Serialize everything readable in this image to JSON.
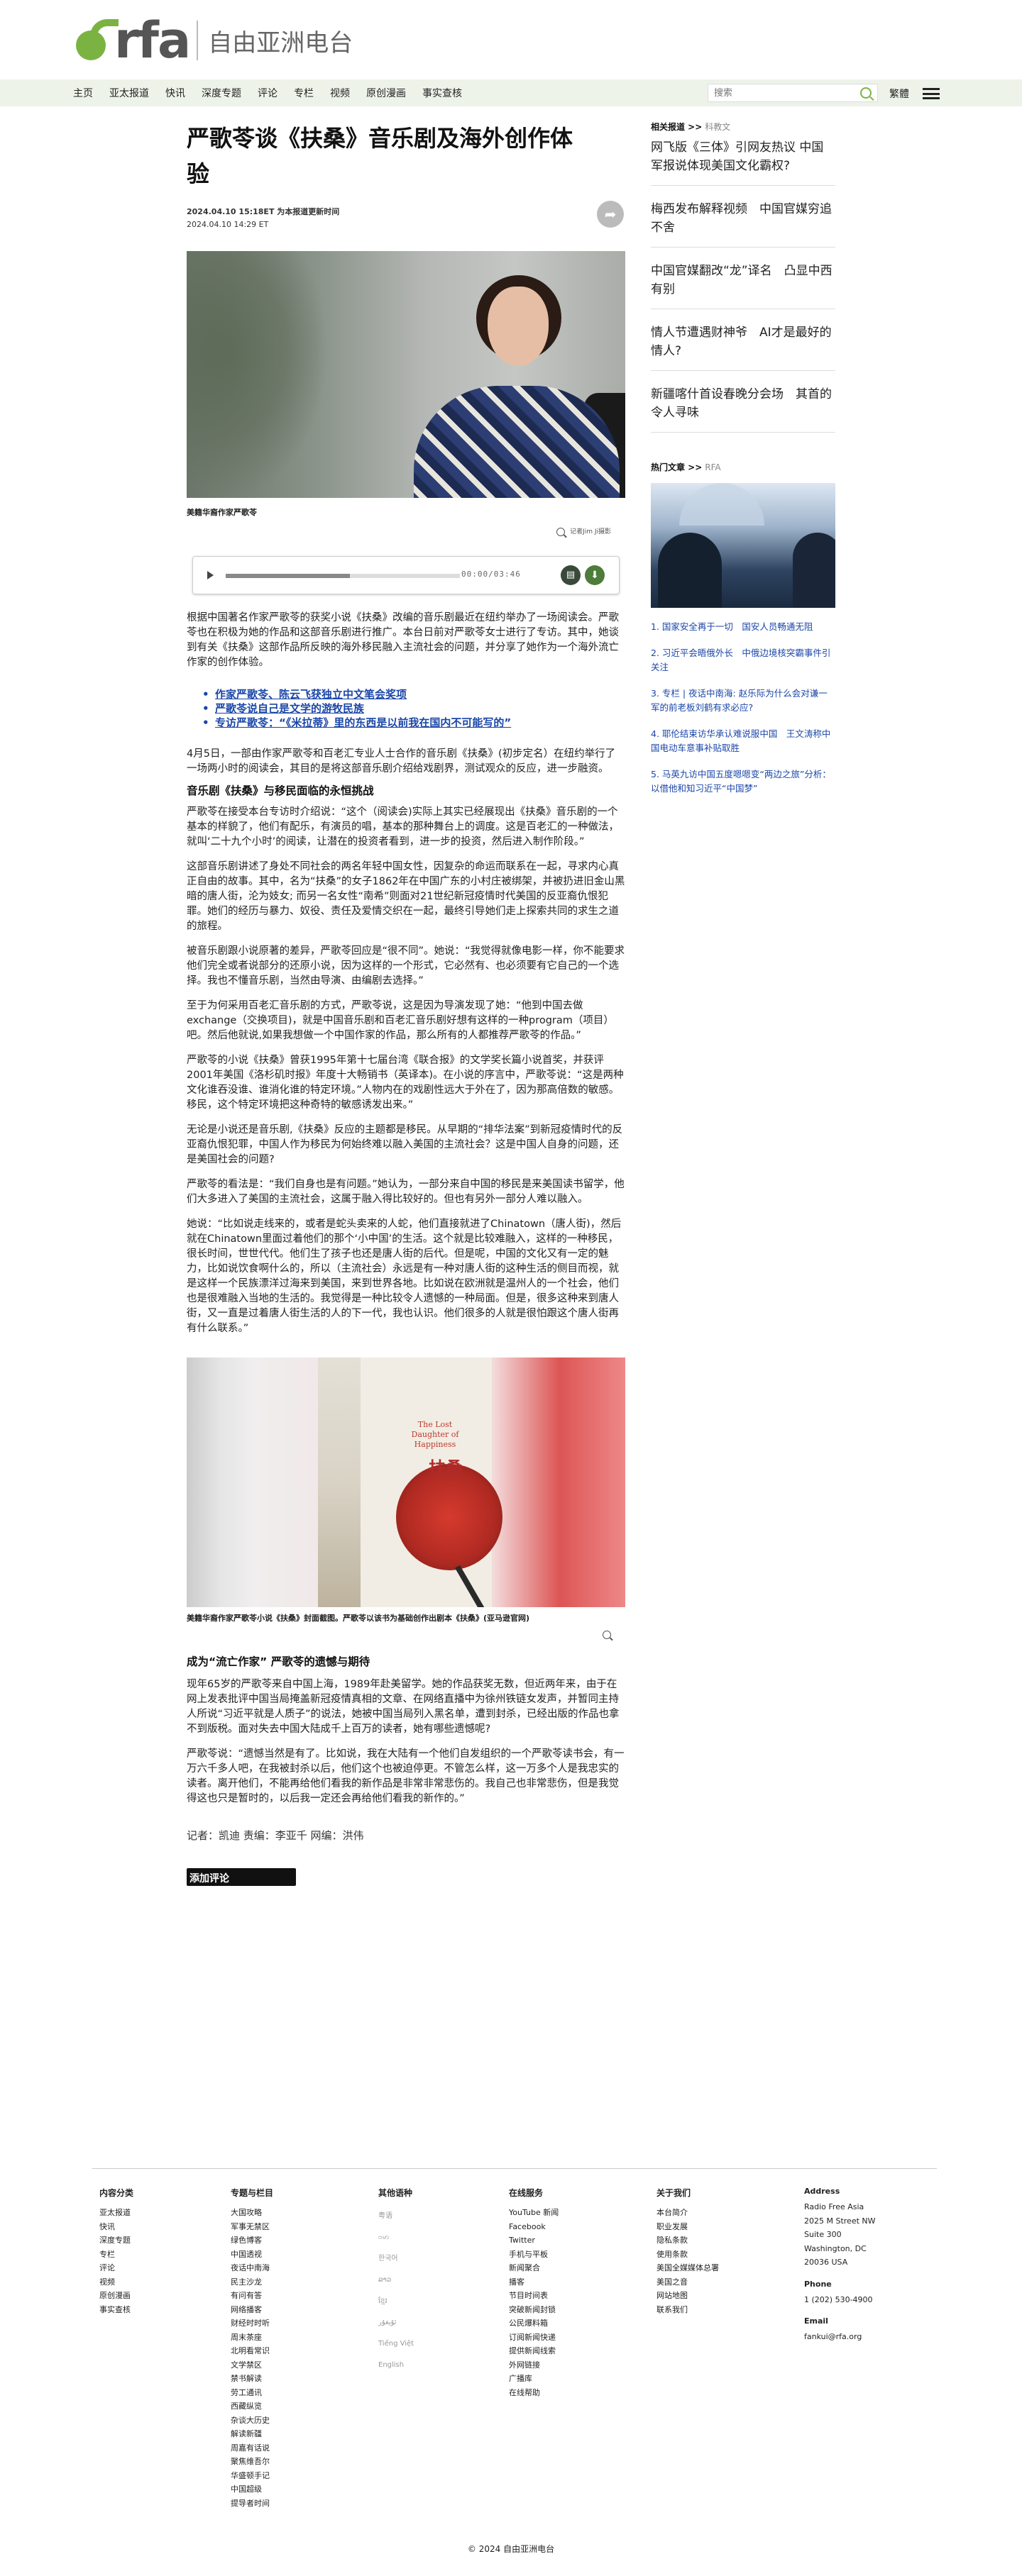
{
  "site": {
    "logo_text": "rfa",
    "logo_cn": "自由亚洲电台"
  },
  "nav": {
    "items": [
      "主页",
      "亚太报道",
      "快讯",
      "深度专题",
      "评论",
      "专栏",
      "视频",
      "原创漫画",
      "事实查核"
    ],
    "search_placeholder": "搜索",
    "lang": "繁體"
  },
  "article": {
    "title_line1": "严歌苓谈《扶桑》音乐剧及海外创作体",
    "title_line2": "验",
    "date_updated": "2024.04.10 15:18ET 为本报道更新时间",
    "date_published": "2024.04.10 14:29 ET",
    "hero_caption": "美籍华裔作家严歌苓",
    "zoom_label": "记者Jim Ji摄影",
    "audio_time": "00:00/03:46",
    "audio_progress": 0.53,
    "lead": "根据中国著名作家严歌苓的获奖小说《扶桑》改编的音乐剧最近在纽约举办了一场阅读会。严歌苓也在积极为她的作品和这部音乐剧进行推广。本台日前对严歌苓女士进行了专访。其中，她谈到有关《扶桑》这部作品所反映的海外移民融入主流社会的问题，并分享了她作为一个海外流亡作家的创作体验。",
    "related_links": [
      "作家严歌苓、陈云飞获独立中文笔会奖项",
      "严歌苓说自己是文学的游牧民族",
      "专访严歌苓：“《米拉蒂》里的东西是以前我在国内不可能写的”"
    ],
    "p1": "4月5日，一部由作家严歌苓和百老汇专业人士合作的音乐剧《扶桑》(初步定名）在纽约举行了一场两小时的阅读会，其目的是将这部音乐剧介绍给戏剧界，测试观众的反应，进一步融资。",
    "subhead1": "音乐剧《扶桑》与移民面临的永恒挑战",
    "p2": "严歌苓在接受本台专访时介绍说：“这个（阅读会)实际上其实已经展现出《扶桑》音乐剧的一个基本的样貌了，他们有配乐，有演员的唱，基本的那种舞台上的调度。这是百老汇的一种做法，就叫‘二十九个小时’的阅读，让潜在的投资者看到，进一步的投资，然后进入制作阶段。”",
    "p3": "这部音乐剧讲述了身处不同社会的两名年轻中国女性，因复杂的命运而联系在一起，寻求内心真正自由的故事。其中，名为“扶桑”的女子1862年在中国广东的小村庄被绑架，并被扔进旧金山黑暗的唐人街，沦为妓女; 而另一名女性“南希”则面对21世纪新冠疫情时代美国的反亚裔仇恨犯罪。她们的经历与暴力、奴役、责任及爱情交织在一起，最终引导她们走上探索共同的求生之道的旅程。",
    "p4": "被音乐剧跟小说原著的差异，严歌苓回应是“很不同”。她说：“我觉得就像电影一样，你不能要求他们完全或者说部分的还原小说，因为这样的一个形式，它必然有、也必须要有它自己的一个选择。我也不懂音乐剧，当然由导演、由编剧去选择。”",
    "p5": "至于为何采用百老汇音乐剧的方式，严歌苓说，这是因为导演发现了她：“他到中国去做exchange（交换项目)，就是中国音乐剧和百老汇音乐剧好想有这样的一种program（项目）吧。然后他就说,如果我想做一个中国作家的作品，那么所有的人都推荐严歌苓的作品。”",
    "p6": "严歌苓的小说《扶桑》曾获1995年第十七届台湾《联合报》的文学奖长篇小说首奖，并获评2001年美国《洛杉矶时报》年度十大畅销书（英译本)。在小说的序言中，严歌苓说：“这是两种文化谁吞没谁、谁消化谁的特定环境。”人物内在的戏剧性远大于外在了，因为那高倍数的敏感。移民，这个特定环境把这种奇特的敏感诱发出来。”",
    "p7": "无论是小说还是音乐剧,《扶桑》反应的主题都是移民。从早期的“排华法案”到新冠疫情时代的反亚裔仇恨犯罪，中国人作为移民为何始终难以融入美国的主流社会？这是中国人自身的问题，还是美国社会的问题?",
    "p8": "严歌苓的看法是：“我们自身也是有问题。”她认为，一部分来自中国的移民是来美国读书留学，他们大多进入了美国的主流社会，这属于融入得比较好的。但也有另外一部分人难以融入。",
    "p9": "她说：“比如说走线来的，或者是蛇头卖来的人蛇，他们直接就进了Chinatown（唐人街)，然后就在Chinatown里面过着他们的那个‘小中国’的生活。这个就是比较难融入，这样的一种移民，很长时间，世世代代。他们生了孩子也还是唐人街的后代。但是呢，中国的文化又有一定的魅力，比如说饮食啊什么的，所以（主流社会）永远是有一种对唐人街的这种生活的侧目而视，就是这样一个民族漂洋过海来到美国，来到世界各地。比如说在欧洲就是温州人的一个社会，他们也是很难融入当地的生活的。我觉得是一种比较令人遗憾的一种局面。但是，很多这种来到唐人街，又一直是过着唐人街生活的人的下一代，我也认识。他们很多的人就是很怕跟这个唐人街再有什么联系。”",
    "book_cover_title": "扶桑",
    "book_cover_en": "The Lost Daughter of Happiness",
    "book_caption": "美籍华裔作家严歌苓小说《扶桑》封面截图。严歌苓以该书为基础创作出剧本《扶桑》(亚马逊官网)",
    "subhead2": "成为“流亡作家” 严歌苓的遗憾与期待",
    "p10": "现年65岁的严歌苓来自中国上海，1989年赴美留学。她的作品获奖无数，但近两年来，由于在网上发表批评中国当局掩盖新冠疫情真相的文章、在网络直播中为徐州铁链女发声，并暂同主持人所说“习近平就是人质子”的说法，她被中国当局列入黑名单，遭到封杀，已经出版的作品也拿不到版税。面对失去中国大陆成千上百万的读者，她有哪些遗憾呢?",
    "p11": "严歌苓说：“遗憾当然是有了。比如说，我在大陆有一个他们自发组织的一个严歌苓读书会，有一万六千多人吧，在我被封杀以后，他们这个也被迫停更。不管怎么样，这一万多个人是我忠实的读者。离开他们，不能再给他们看我的新作品是非常非常悲伤的。我自己也非常悲伤，但是我觉得这也只是暂时的，以后我一定还会再给他们看我的新作的。”",
    "byline": "记者：凯迪   责编：李亚千   网编：洪伟",
    "add_comment": "添加评论"
  },
  "sidebar": {
    "related_head": "相关报道 >>",
    "related_sub": "科教文",
    "related_items": [
      "网飞版《三体》引网友热议 中国军报说体现美国文化霸权?",
      "梅西发布解释视频　中国官媒穷追不舍",
      "中国官媒翻改“龙”译名　凸显中西有别",
      "情人节遭遇财神爷　AI才是最好的情人?",
      "新疆喀什首设春晚分会场　其首的令人寻味"
    ],
    "hot_head": "热门文章 >>",
    "hot_sub": "RFA",
    "hot_items": [
      "1. 国家安全再于一切　国安人员畅通无阻",
      "2. 习近平会晤俄外长　中俄边境核突霸事件引关注",
      "3. 专栏 | 夜话中南海: 赵乐际为什么会对谦一军的前老板刘鹤有求必应?",
      "4. 耶伦结束访华承认难说服中国　王文涛称中国电动车意事补贴取胜",
      "5. 马英九访中国五度嗯嗯变“两边之旅”分析：以借他和知习近平“中国梦”"
    ]
  },
  "footer": {
    "cols": [
      {
        "head": "内容分类",
        "items": [
          "亚太报道",
          "快讯",
          "深度专题",
          "专栏",
          "评论",
          "视频",
          "原创漫画",
          "事实查核"
        ]
      },
      {
        "head": "专题与栏目",
        "items": [
          "大国攻略",
          "军事无禁区",
          "绿色博客",
          "中国透视",
          "夜话中南海",
          "民主沙龙",
          "有问有答",
          "网络播客",
          "财经时时听",
          "周末茶座",
          "北明看常识",
          "文学禁区",
          "禁书解读",
          "劳工通讯",
          "西藏纵览",
          "杂谈大历史",
          "解读新疆",
          "周嘉有话说",
          "聚焦维吾尔",
          "华盛顿手记",
          "中国超级",
          "提导者时间"
        ]
      },
      {
        "head": "其他语种",
        "items": [
          "粤语",
          "ဗမာ",
          "한국어",
          "ລາວ",
          "ខ្មែរ",
          "ئۇيغۇر",
          "Tiếng Việt",
          "English"
        ]
      },
      {
        "head": "在线服务",
        "items": [
          "YouTube 新闻",
          "Facebook",
          "Twitter",
          "手机与平板",
          "新闻聚合",
          "播客",
          "节目时间表",
          "突破新闻封锁",
          "公民爆料箱",
          "订阅新闻快递",
          "提供新闻线索",
          "外网链接",
          "广播库",
          "在线帮助"
        ]
      },
      {
        "head": "关于我们",
        "items": [
          "本台简介",
          "职业发展",
          "隐私条款",
          "使用条款",
          "美国全媒媒体总署",
          "美国之音",
          "网站地图",
          "联系我们"
        ]
      }
    ],
    "address_head": "Address",
    "address_lines": [
      "Radio Free Asia",
      "2025 M Street NW",
      "Suite 300",
      "Washington, DC",
      "20036 USA"
    ],
    "phone_head": "Phone",
    "phone": "1 (202) 530-4900",
    "email_head": "Email",
    "email": "fankui@rfa.org",
    "copyright": "© 2024 自由亚洲电台"
  }
}
